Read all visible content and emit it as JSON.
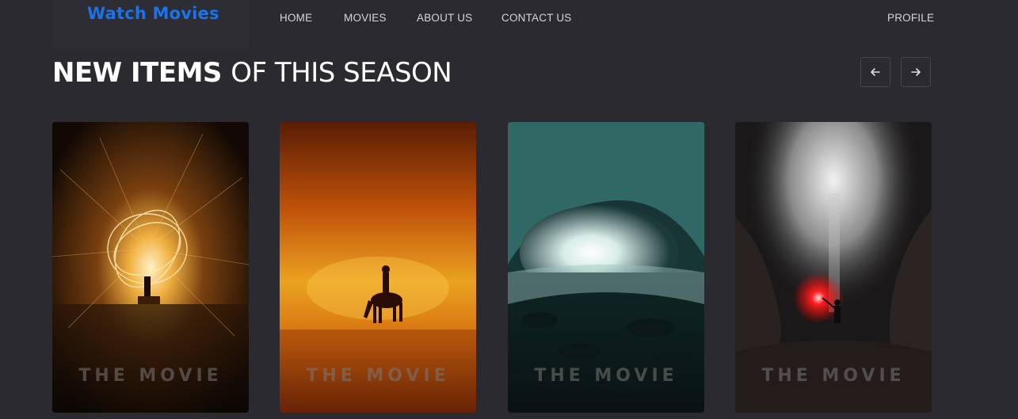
{
  "header": {
    "logo": "Watch Movies",
    "nav": [
      "HOME",
      "MOVIES",
      "ABOUT US",
      "CONTACT US"
    ],
    "profile": "PROFILE"
  },
  "section": {
    "title_strong": "NEW ITEMS",
    "title_rest": "OF THIS SEASON",
    "prev_icon": "arrow-left-icon",
    "next_icon": "arrow-right-icon"
  },
  "cards": [
    {
      "caption": "THE MOVIE",
      "image": "steel-wool-sparks-poster"
    },
    {
      "caption": "THE MOVIE",
      "image": "horse-rider-sunset-poster"
    },
    {
      "caption": "THE MOVIE",
      "image": "ice-cave-poster"
    },
    {
      "caption": "THE MOVIE",
      "image": "cave-flare-poster"
    }
  ],
  "colors": {
    "background": "#2b2a30",
    "logo": "#1a73e8",
    "text": "#ffffff"
  }
}
